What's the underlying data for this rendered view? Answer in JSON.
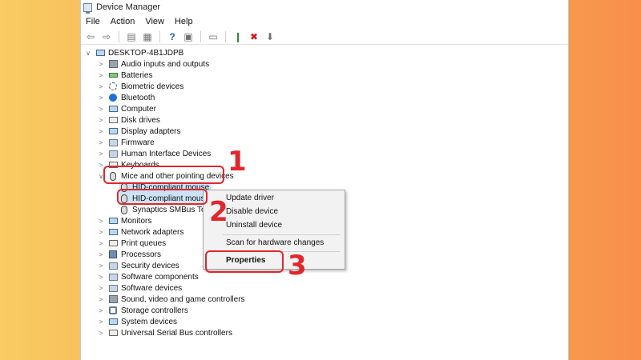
{
  "window": {
    "title": "Device Manager"
  },
  "menu": [
    "File",
    "Action",
    "View",
    "Help"
  ],
  "toolbar": {
    "back": "⇦",
    "forward": "⇨",
    "show_hide": "▤",
    "properties": "▦",
    "help": "?",
    "view": "▣",
    "monitor": "▭",
    "add_driver": "❙",
    "uninstall": "✖",
    "download": "⬇",
    "uninstall_color": "#d8141b",
    "help_color": "#1c5fb3"
  },
  "tree": {
    "root": "DESKTOP-4B1JDPB",
    "items": [
      "Audio inputs and outputs",
      "Batteries",
      "Biometric devices",
      "Bluetooth",
      "Computer",
      "Disk drives",
      "Display adapters",
      "Firmware",
      "Human Interface Devices",
      "Keyboards",
      "Mice and other pointing devices",
      "Monitors",
      "Network adapters",
      "Print queues",
      "Processors",
      "Security devices",
      "Software components",
      "Software devices",
      "Sound, video and game controllers",
      "Storage controllers",
      "System devices",
      "Universal Serial Bus controllers"
    ],
    "mice_children": [
      "HID-compliant mouse",
      "HID-compliant mouse",
      "Synaptics SMBus Touc"
    ]
  },
  "context_menu": {
    "update": "Update driver",
    "disable": "Disable device",
    "uninstall": "Uninstall device",
    "scan": "Scan for hardware changes",
    "properties": "Properties"
  },
  "annotations": {
    "labels": [
      "1",
      "2",
      "3"
    ],
    "color": "#e3262b"
  },
  "colors": {
    "background_left": "#f8cc62",
    "background_right": "#f88f4a",
    "selection": "#cce3f7"
  }
}
